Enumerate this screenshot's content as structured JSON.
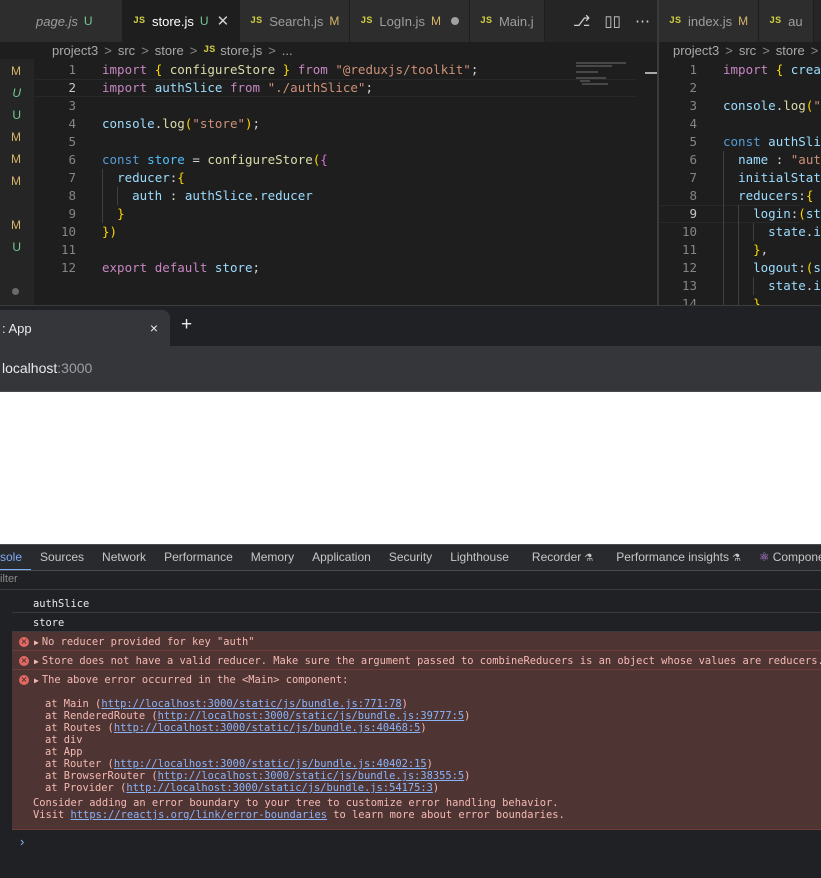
{
  "editor_left": {
    "tabs": [
      {
        "name": "page.js",
        "status": "U",
        "italic": true,
        "partial": true
      },
      {
        "name": "store.js",
        "status": "U",
        "active": true
      },
      {
        "name": "Search.js",
        "status": "M"
      },
      {
        "name": "LogIn.js",
        "status": "M",
        "dirty": true
      },
      {
        "name": "Main.j",
        "status": ""
      }
    ],
    "breadcrumb": [
      "project3",
      "src",
      "store",
      "store.js",
      "..."
    ],
    "explorer_status": [
      "M",
      "U",
      "U",
      "M",
      "M",
      "M",
      "M",
      "U"
    ],
    "lines": [
      {
        "n": "1",
        "t": "import { configureStore } from \"@reduxjs/toolkit\";"
      },
      {
        "n": "2",
        "t": "import authSlice from \"./authSlice\";"
      },
      {
        "n": "3",
        "t": ""
      },
      {
        "n": "4",
        "t": "console.log(\"store\");"
      },
      {
        "n": "5",
        "t": ""
      },
      {
        "n": "6",
        "t": "const store = configureStore({"
      },
      {
        "n": "7",
        "t": "  reducer:{"
      },
      {
        "n": "8",
        "t": "    auth : authSlice.reducer"
      },
      {
        "n": "9",
        "t": "  }"
      },
      {
        "n": "10",
        "t": "})"
      },
      {
        "n": "11",
        "t": ""
      },
      {
        "n": "12",
        "t": "export default store;"
      }
    ],
    "current_line": 2
  },
  "editor_right": {
    "tabs": [
      {
        "name": "index.js",
        "status": "M"
      },
      {
        "name": "au",
        "status": ""
      }
    ],
    "breadcrumb": [
      "project3",
      "src",
      "store",
      ">"
    ],
    "lines": [
      {
        "n": "1",
        "t": "import { creat"
      },
      {
        "n": "2",
        "t": ""
      },
      {
        "n": "3",
        "t": "console.log(\"a"
      },
      {
        "n": "4",
        "t": ""
      },
      {
        "n": "5",
        "t": "const authSlic"
      },
      {
        "n": "6",
        "t": "  name : \"auth"
      },
      {
        "n": "7",
        "t": "  initialState"
      },
      {
        "n": "8",
        "t": "  reducers:{"
      },
      {
        "n": "9",
        "t": "    login:(sta"
      },
      {
        "n": "10",
        "t": "      state.is"
      },
      {
        "n": "11",
        "t": "    },"
      },
      {
        "n": "12",
        "t": "    logout:(st"
      },
      {
        "n": "13",
        "t": "      state.is"
      },
      {
        "n": "14",
        "t": "    }"
      }
    ],
    "current_line": 9
  },
  "browser": {
    "tab_title": ": App",
    "close": "×",
    "new_tab": "+",
    "address_host": "localhost",
    "address_port": ":3000"
  },
  "devtools": {
    "tabs": [
      "sole",
      "Sources",
      "Network",
      "Performance",
      "Memory",
      "Application",
      "Security",
      "Lighthouse",
      "Recorder",
      "Performance insights",
      "Componen"
    ],
    "active_tab": "sole",
    "filter_placeholder": "ilter",
    "logs": [
      {
        "type": "log",
        "text": "authSlice"
      },
      {
        "type": "log",
        "text": "store"
      },
      {
        "type": "error",
        "text": "No reducer provided for key \"auth\""
      },
      {
        "type": "error",
        "text": "Store does not have a valid reducer. Make sure the argument passed to combineReducers is an object whose values are reducers."
      },
      {
        "type": "error",
        "text": "The above error occurred in the <Main> component:"
      }
    ],
    "stack": [
      {
        "at": "at Main (",
        "link": "http://localhost:3000/static/js/bundle.js:771:78",
        "end": ")"
      },
      {
        "at": "at RenderedRoute (",
        "link": "http://localhost:3000/static/js/bundle.js:39777:5",
        "end": ")"
      },
      {
        "at": "at Routes (",
        "link": "http://localhost:3000/static/js/bundle.js:40468:5",
        "end": ")"
      },
      {
        "at": "at div",
        "link": "",
        "end": ""
      },
      {
        "at": "at App",
        "link": "",
        "end": ""
      },
      {
        "at": "at Router (",
        "link": "http://localhost:3000/static/js/bundle.js:40402:15",
        "end": ")"
      },
      {
        "at": "at BrowserRouter (",
        "link": "http://localhost:3000/static/js/bundle.js:38355:5",
        "end": ")"
      },
      {
        "at": "at Provider (",
        "link": "http://localhost:3000/static/js/bundle.js:54175:3",
        "end": ")"
      }
    ],
    "note_line1": "Consider adding an error boundary to your tree to customize error handling behavior.",
    "note_line2_pre": "Visit ",
    "note_link": "https://reactjs.org/link/error-boundaries",
    "note_line2_post": " to learn more about error boundaries.",
    "prompt": "›"
  }
}
